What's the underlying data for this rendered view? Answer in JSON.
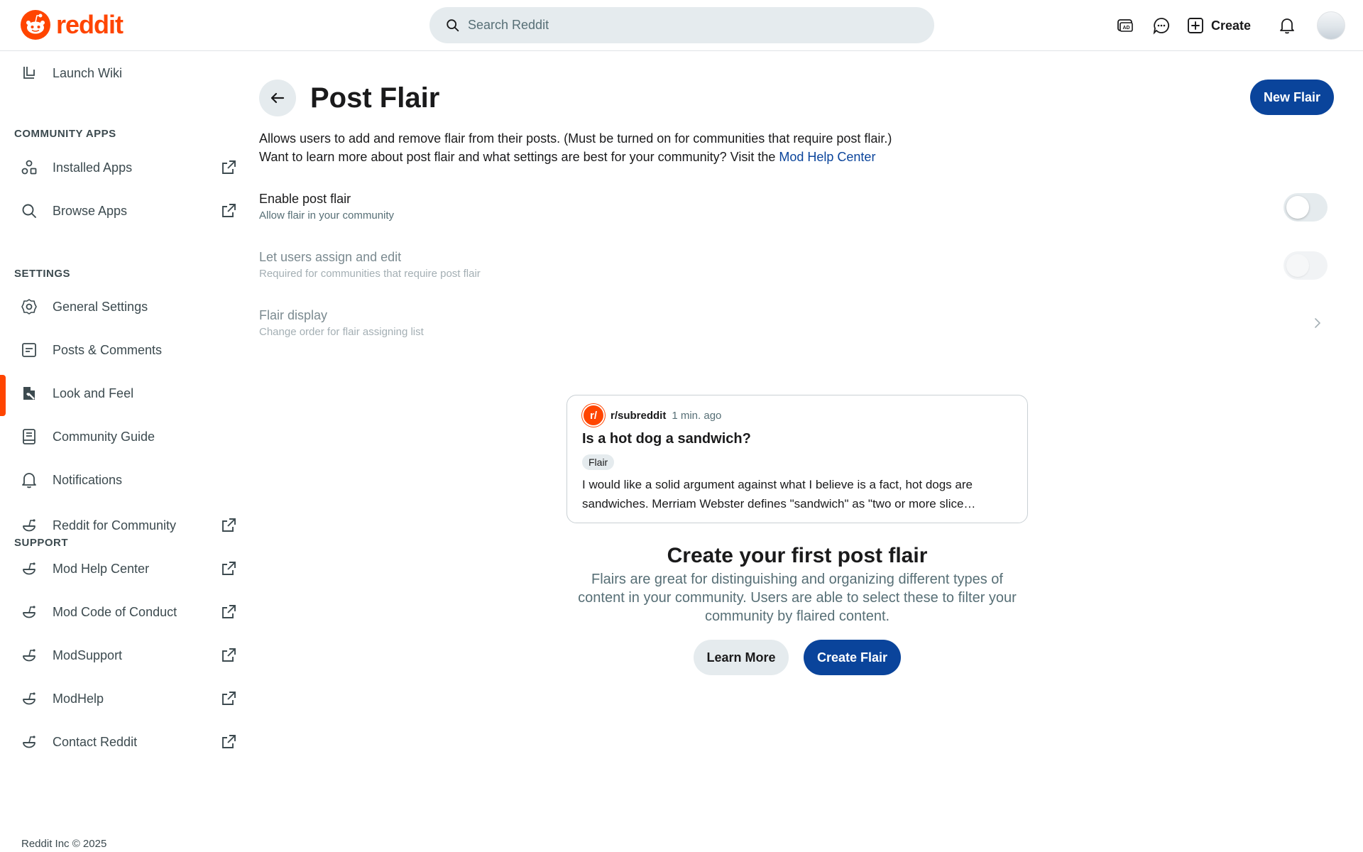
{
  "header": {
    "logo_text": "reddit",
    "search_placeholder": "Search Reddit",
    "create_label": "Create",
    "icons": [
      "advertise-icon",
      "chat-icon",
      "create-icon",
      "notification-icon"
    ]
  },
  "sidebar": {
    "launch_wiki": "Launch Wiki",
    "sections": {
      "community_apps": "COMMUNITY APPS",
      "settings": "SETTINGS",
      "support": "SUPPORT"
    },
    "community_apps": [
      {
        "label": "Installed Apps",
        "icon": "installed-apps-icon",
        "external": true
      },
      {
        "label": "Browse Apps",
        "icon": "search-icon",
        "external": true
      }
    ],
    "settings": [
      {
        "label": "General Settings",
        "icon": "gear-icon"
      },
      {
        "label": "Posts & Comments",
        "icon": "post-icon"
      },
      {
        "label": "Look and Feel",
        "icon": "brush-icon",
        "active": true
      },
      {
        "label": "Community Guide",
        "icon": "guide-icon"
      },
      {
        "label": "Notifications",
        "icon": "bell-icon"
      }
    ],
    "support": [
      {
        "label": "Reddit for Community",
        "icon": "snoo-icon",
        "external": true
      },
      {
        "label": "Mod Help Center",
        "icon": "snoo-icon",
        "external": true
      },
      {
        "label": "Mod Code of Conduct",
        "icon": "snoo-icon",
        "external": true
      },
      {
        "label": "ModSupport",
        "icon": "snoo-icon",
        "external": true
      },
      {
        "label": "ModHelp",
        "icon": "snoo-icon",
        "external": true
      },
      {
        "label": "Contact Reddit",
        "icon": "snoo-icon",
        "external": true
      }
    ],
    "footer": "Reddit Inc © 2025"
  },
  "main": {
    "title": "Post Flair",
    "new_flair_label": "New Flair",
    "description_line1": "Allows users to add and remove flair from their posts. (Must be turned on for communities that require post flair.)",
    "description_line2": "Want to learn more about post flair and what settings are best for your community? Visit the",
    "help_link": "Mod Help Center",
    "settings": [
      {
        "title": "Enable post flair",
        "subtitle": "Allow flair in your community",
        "enabled": false
      },
      {
        "title": "Let users assign and edit",
        "subtitle": "Required for communities that require post flair",
        "enabled": false
      },
      {
        "title": "Flair display",
        "subtitle": "Change order for flair assigning list"
      }
    ],
    "preview": {
      "subreddit": "r/subreddit",
      "time": "1 min. ago",
      "post_title": "Is a hot dog a sandwich?",
      "flair": "Flair",
      "body": "I would like a solid argument against what I believe is a fact, hot dogs are sandwiches. Merriam Webster defines \"sandwich\" as \"two or more slice…"
    },
    "empty_title": "Create your first post flair",
    "empty_description": "Flairs are great for distinguishing and organizing different types of content in your community. Users are able to select these to filter your community by flaired content.",
    "learn_more_label": "Learn More",
    "create_flair_label": "Create Flair"
  },
  "colors": {
    "brand": "#ff4500",
    "primary_button": "#0a449b",
    "secondary_button": "#e5ebee"
  }
}
